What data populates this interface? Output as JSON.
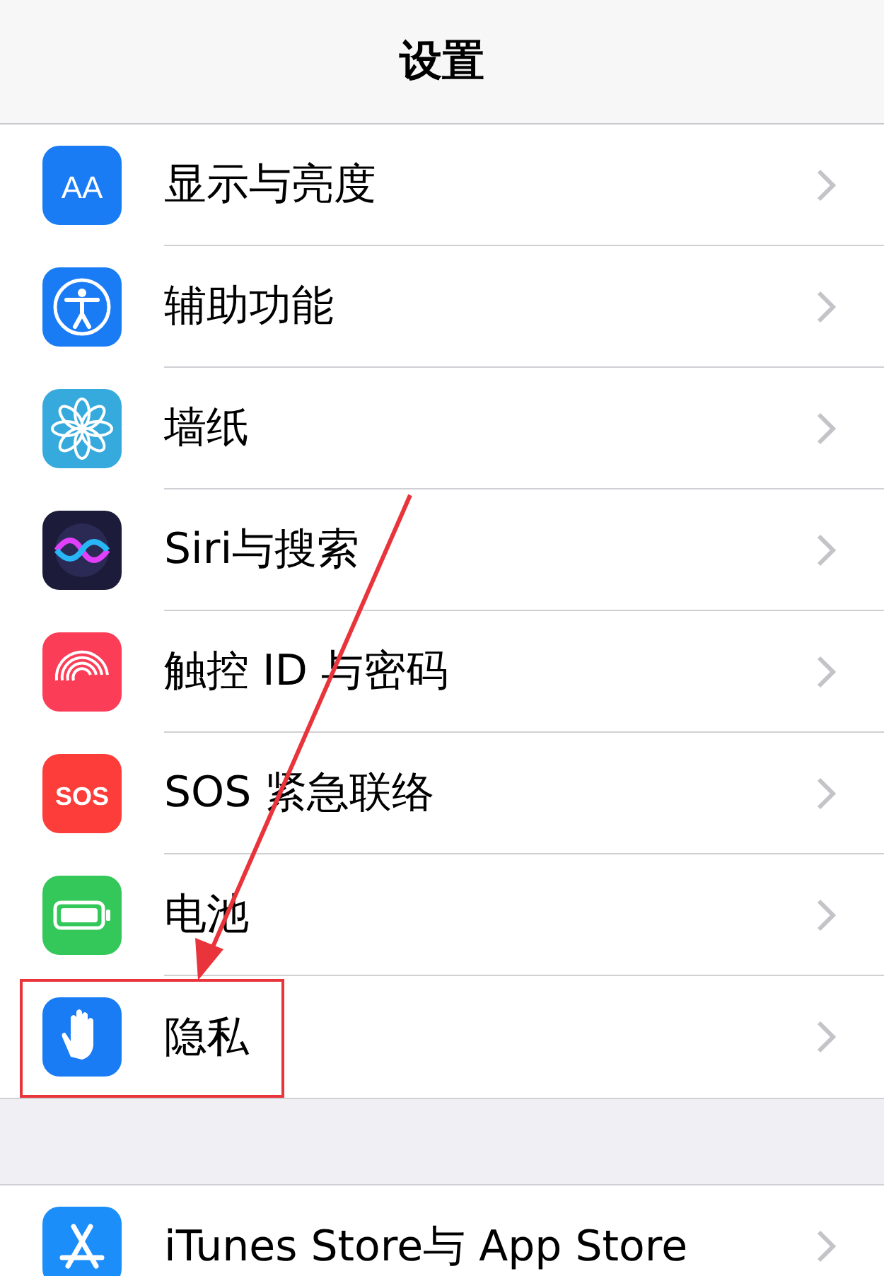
{
  "header": {
    "title": "设置"
  },
  "groups": [
    {
      "rows": [
        {
          "label": "显示与亮度",
          "kind": "display",
          "color": "#1a7cf5",
          "icon_text": "AA",
          "highlighted": false
        },
        {
          "label": "辅助功能",
          "kind": "accessibility",
          "color": "#1a7cf5",
          "highlighted": false
        },
        {
          "label": "墙纸",
          "kind": "wallpaper",
          "color": "#36aadc",
          "highlighted": false
        },
        {
          "label": "Siri与搜索",
          "kind": "siri",
          "color": "#1c1c3a",
          "highlighted": false
        },
        {
          "label": "触控 ID 与密码",
          "kind": "touchid",
          "color": "#fc3d57",
          "highlighted": false
        },
        {
          "label": "SOS 紧急联络",
          "kind": "sos",
          "color": "#fc3d39",
          "icon_text": "SOS",
          "highlighted": false
        },
        {
          "label": "电池",
          "kind": "battery",
          "color": "#34c759",
          "highlighted": false
        },
        {
          "label": "隐私",
          "kind": "privacy",
          "color": "#1a7cf5",
          "highlighted": true
        }
      ]
    },
    {
      "rows": [
        {
          "label": "iTunes Store与 App Store",
          "kind": "appstore",
          "color": "#1c8ef9",
          "highlighted": false
        }
      ]
    }
  ]
}
